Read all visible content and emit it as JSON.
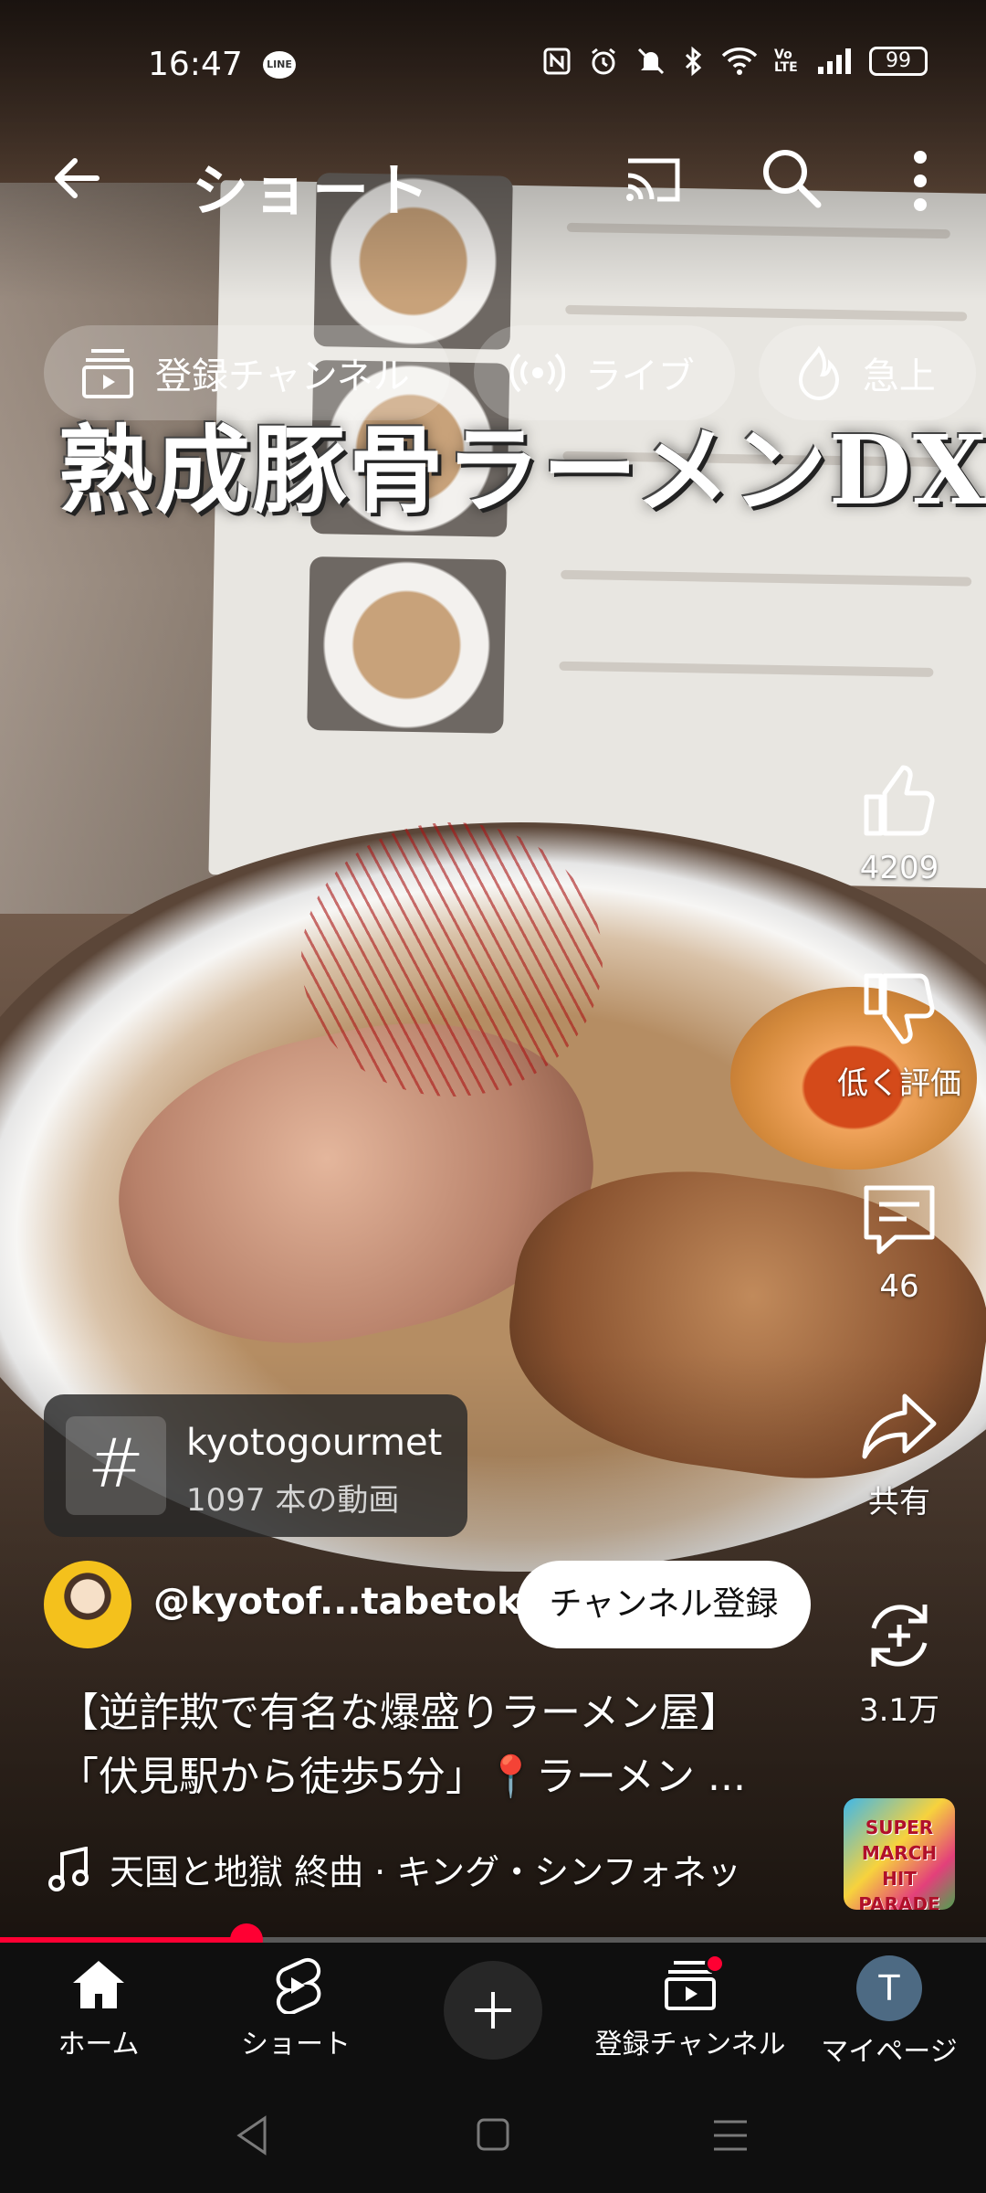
{
  "status_bar": {
    "time": "16:47",
    "line_badge": "LINE",
    "volte": "Vo LTE",
    "battery": "99"
  },
  "topbar": {
    "title": "ショート",
    "icons": [
      "back-arrow-icon",
      "cast-icon",
      "search-icon",
      "more-vert-icon"
    ]
  },
  "chips": [
    {
      "label": "登録チャンネル",
      "icon": "subscriptions-icon"
    },
    {
      "label": "ライブ",
      "icon": "live-icon"
    },
    {
      "label": "急上",
      "icon": "trending-icon"
    }
  ],
  "video": {
    "overlay_title": "熟成豚骨ラーメンDX"
  },
  "actions": {
    "like_count": "4209",
    "dislike_label": "低く評価",
    "comment_count": "46",
    "share_label": "共有",
    "remix_count": "3.1万"
  },
  "hashtag": {
    "symbol": "#",
    "name": "kyotogourmet",
    "count": "1097 本の動画"
  },
  "channel": {
    "handle": "@kyotof...tabetoku",
    "subscribe_label": "チャンネル登録"
  },
  "description": {
    "line1": "【逆詐欺で有名な爆盛りラーメン屋】",
    "line2": "「伏見駅から徒歩5分」📍ラーメン ..."
  },
  "music": {
    "text": "天国と地獄 終曲 · キング・シンフォネッ",
    "thumb_lines": [
      "SUPER",
      "MARCH",
      "HIT PARADE"
    ]
  },
  "progress": {
    "fraction": 0.25
  },
  "bottom_nav": {
    "home": "ホーム",
    "shorts": "ショート",
    "subscriptions": "登録チャンネル",
    "mypage": "マイページ",
    "avatar_initial": "T"
  },
  "colors": {
    "accent": "#ff0033",
    "nav_bg": "#0f0f0f"
  }
}
